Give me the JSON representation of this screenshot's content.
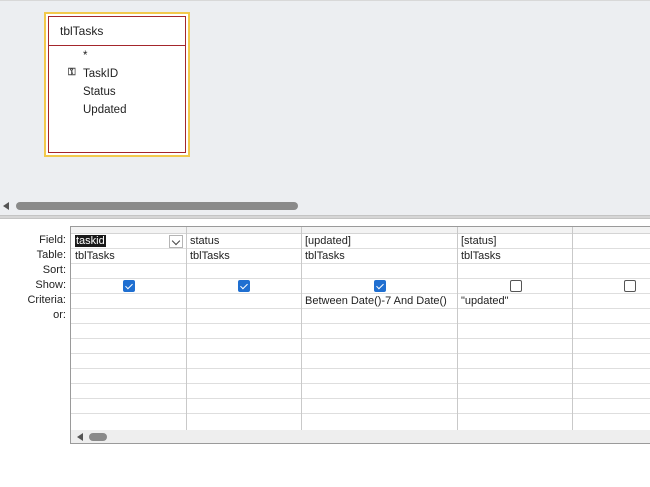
{
  "table": {
    "name": "tblTasks",
    "fields": [
      {
        "label": "*",
        "is_key": false
      },
      {
        "label": "TaskID",
        "is_key": true
      },
      {
        "label": "Status",
        "is_key": false
      },
      {
        "label": "Updated",
        "is_key": false
      }
    ]
  },
  "grid": {
    "row_labels": [
      "Field:",
      "Table:",
      "Sort:",
      "Show:",
      "Criteria:",
      "or:"
    ],
    "columns": [
      {
        "field": "taskid",
        "table": "tblTasks",
        "sort": "",
        "show": true,
        "criteria": "",
        "or": ""
      },
      {
        "field": "status",
        "table": "tblTasks",
        "sort": "",
        "show": true,
        "criteria": "",
        "or": ""
      },
      {
        "field": "[updated]",
        "table": "tblTasks",
        "sort": "",
        "show": true,
        "criteria": "Between Date()-7 And Date()",
        "or": ""
      },
      {
        "field": "[status]",
        "table": "tblTasks",
        "sort": "",
        "show": false,
        "criteria": "\"updated\"",
        "or": ""
      },
      {
        "field": "",
        "table": "",
        "sort": "",
        "show": false,
        "criteria": "",
        "or": ""
      }
    ]
  },
  "colors": {
    "table_border": "#a4262c",
    "table_selected_outline": "#f2c94c",
    "checkbox_on": "#1f6fd1",
    "pane_background": "#eceef1"
  }
}
